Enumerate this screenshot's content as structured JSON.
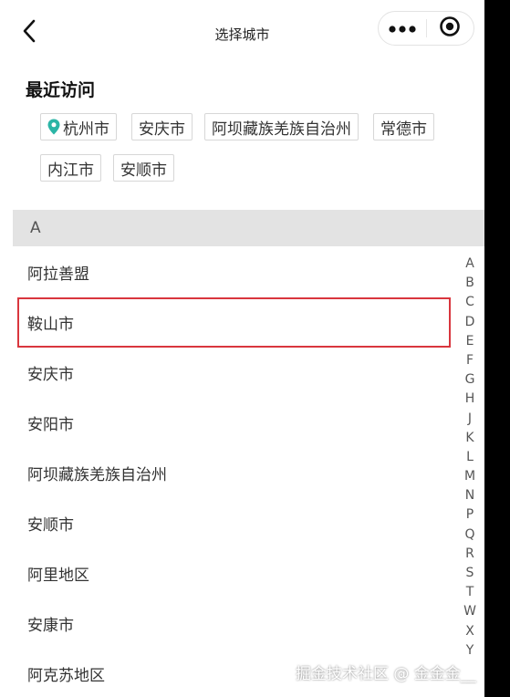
{
  "header": {
    "title": "选择城市",
    "back_icon": "chevron-left-icon",
    "more_icon": "three-dots-icon",
    "close_icon": "target-circle-icon"
  },
  "recent": {
    "title": "最近访问",
    "location_icon": "location-pin-icon",
    "location_icon_color": "#2bb5a6",
    "chips": [
      "杭州市",
      "安庆市",
      "阿坝藏族羌族自治州",
      "常德市",
      "内江市",
      "安顺市"
    ]
  },
  "section": {
    "letter": "A"
  },
  "cities": [
    "阿拉善盟",
    "鞍山市",
    "安庆市",
    "安阳市",
    "阿坝藏族羌族自治州",
    "安顺市",
    "阿里地区",
    "安康市",
    "阿克苏地区"
  ],
  "selected_city": "鞍山市",
  "selection_color": "#d9363e",
  "index_letters": [
    "A",
    "B",
    "C",
    "D",
    "E",
    "F",
    "G",
    "H",
    "J",
    "K",
    "L",
    "M",
    "N",
    "P",
    "Q",
    "R",
    "S",
    "T",
    "W",
    "X",
    "Y"
  ],
  "watermark": "掘金技术社区 @ 金金金__"
}
